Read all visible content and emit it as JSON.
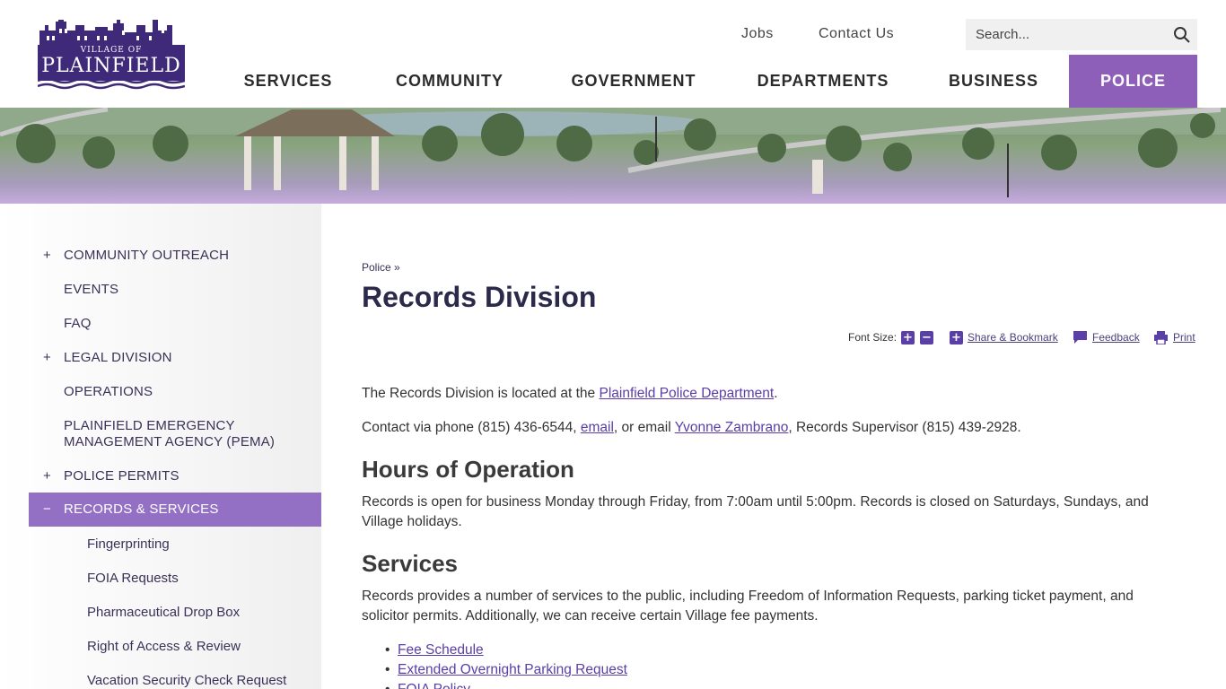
{
  "header": {
    "logo": {
      "top": "VILLAGE OF",
      "name": "PLAINFIELD"
    },
    "top_links": {
      "jobs": "Jobs",
      "contact": "Contact Us"
    },
    "search": {
      "placeholder": "Search..."
    },
    "nav": [
      {
        "label": "SERVICES"
      },
      {
        "label": "COMMUNITY"
      },
      {
        "label": "GOVERNMENT"
      },
      {
        "label": "DEPARTMENTS"
      },
      {
        "label": "BUSINESS"
      },
      {
        "label": "POLICE",
        "active": true
      }
    ]
  },
  "sidebar": {
    "items": [
      {
        "label": "COMMUNITY OUTREACH",
        "expander": "+"
      },
      {
        "label": "EVENTS",
        "expander": ""
      },
      {
        "label": "FAQ",
        "expander": ""
      },
      {
        "label": "LEGAL DIVISION",
        "expander": "+"
      },
      {
        "label": "OPERATIONS",
        "expander": ""
      },
      {
        "label": "PLAINFIELD EMERGENCY",
        "label2": "MANAGEMENT AGENCY (PEMA)",
        "expander": ""
      },
      {
        "label": "POLICE PERMITS",
        "expander": "+"
      },
      {
        "label": "RECORDS & SERVICES",
        "expander": "−",
        "active": true
      }
    ],
    "subitems": [
      {
        "label": "Fingerprinting"
      },
      {
        "label": "FOIA Requests"
      },
      {
        "label": "Pharmaceutical Drop Box"
      },
      {
        "label": "Right of Access & Review"
      },
      {
        "label": "Vacation Security Check Request"
      }
    ]
  },
  "main": {
    "breadcrumb": "Police »",
    "title": "Records Division",
    "tools": {
      "font_size_label": "Font Size:",
      "share": "Share & Bookmark",
      "feedback": "Feedback",
      "print": "Print"
    },
    "intro": {
      "p1_before": "The Records Division is located at the ",
      "p1_link": "Plainfield Police Department",
      "p1_after": ".",
      "p2_before": "Contact via phone (815) 436-6544, ",
      "p2_link1": "email",
      "p2_mid": ", or email ",
      "p2_link2": "Yvonne Zambrano",
      "p2_after": ", Records Supervisor (815) 439-2928."
    },
    "hours": {
      "heading": "Hours of Operation",
      "line1": "Records is open for business Monday through Friday, from 7:00am until 5:00pm. Records is closed on Saturdays, Sundays, and",
      "line2": "Village holidays."
    },
    "services": {
      "heading": "Services",
      "line1": "Records provides a number of services to the public, including Freedom of Information Requests, parking ticket payment, and",
      "line2": "solicitor permits. Additionally, we can receive certain Village fee payments.",
      "links": [
        "Fee Schedule",
        "Extended Overnight Parking Request",
        "FOIA Policy"
      ]
    }
  }
}
